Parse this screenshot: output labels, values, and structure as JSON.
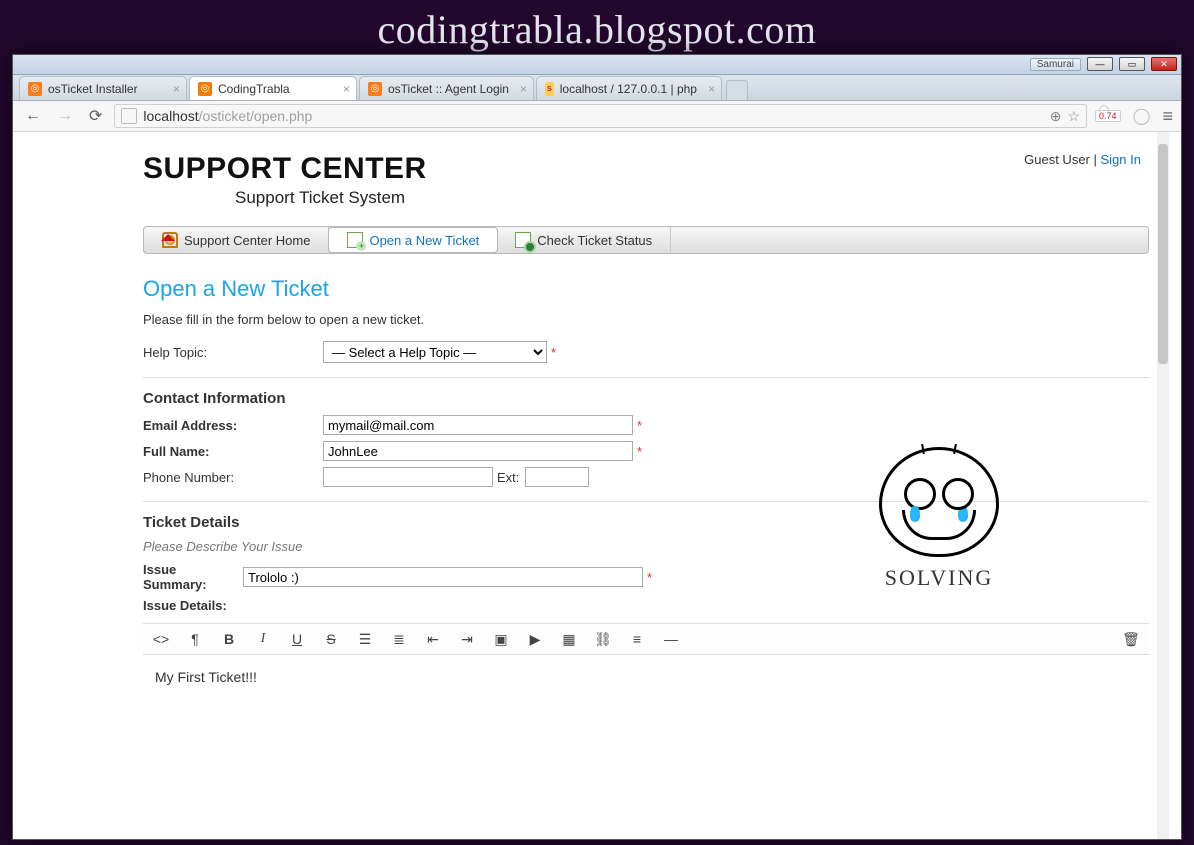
{
  "blog": {
    "title": "codingtrabla.blogspot.com"
  },
  "window": {
    "app_badge": "Samurai"
  },
  "tabs": [
    {
      "label": "osTicket Installer"
    },
    {
      "label": "CodingTrabla"
    },
    {
      "label": "osTicket :: Agent Login"
    },
    {
      "label": "localhost / 127.0.0.1 | php"
    }
  ],
  "address": {
    "host": "localhost",
    "path": "/osticket/open.php"
  },
  "ext": {
    "badge": "0.74"
  },
  "userbar": {
    "guest": "Guest User",
    "sep": " | ",
    "signin": "Sign In"
  },
  "logo": {
    "main": "SUPPORT CENTER",
    "sub": "Support Ticket System"
  },
  "nav": {
    "home": "Support Center Home",
    "open": "Open a New Ticket",
    "check": "Check Ticket Status"
  },
  "page_title": "Open a New Ticket",
  "instructions": "Please fill in the form below to open a new ticket.",
  "help_topic": {
    "label": "Help Topic:",
    "selected": "— Select a Help Topic —"
  },
  "contact": {
    "heading": "Contact Information",
    "email_label": "Email Address:",
    "email_value": "mymail@mail.com",
    "fullname_label": "Full Name:",
    "fullname_value": "JohnLee",
    "phone_label": "Phone Number:",
    "phone_value": "",
    "ext_label": "Ext:",
    "ext_value": ""
  },
  "details": {
    "heading": "Ticket Details",
    "hint": "Please Describe Your Issue",
    "summary_label": "Issue Summary:",
    "summary_value": "Trololo :)",
    "details_label": "Issue Details:",
    "body": "My First Ticket!!!"
  },
  "overlay": {
    "label": "SOLVING"
  },
  "asterisk": "*"
}
